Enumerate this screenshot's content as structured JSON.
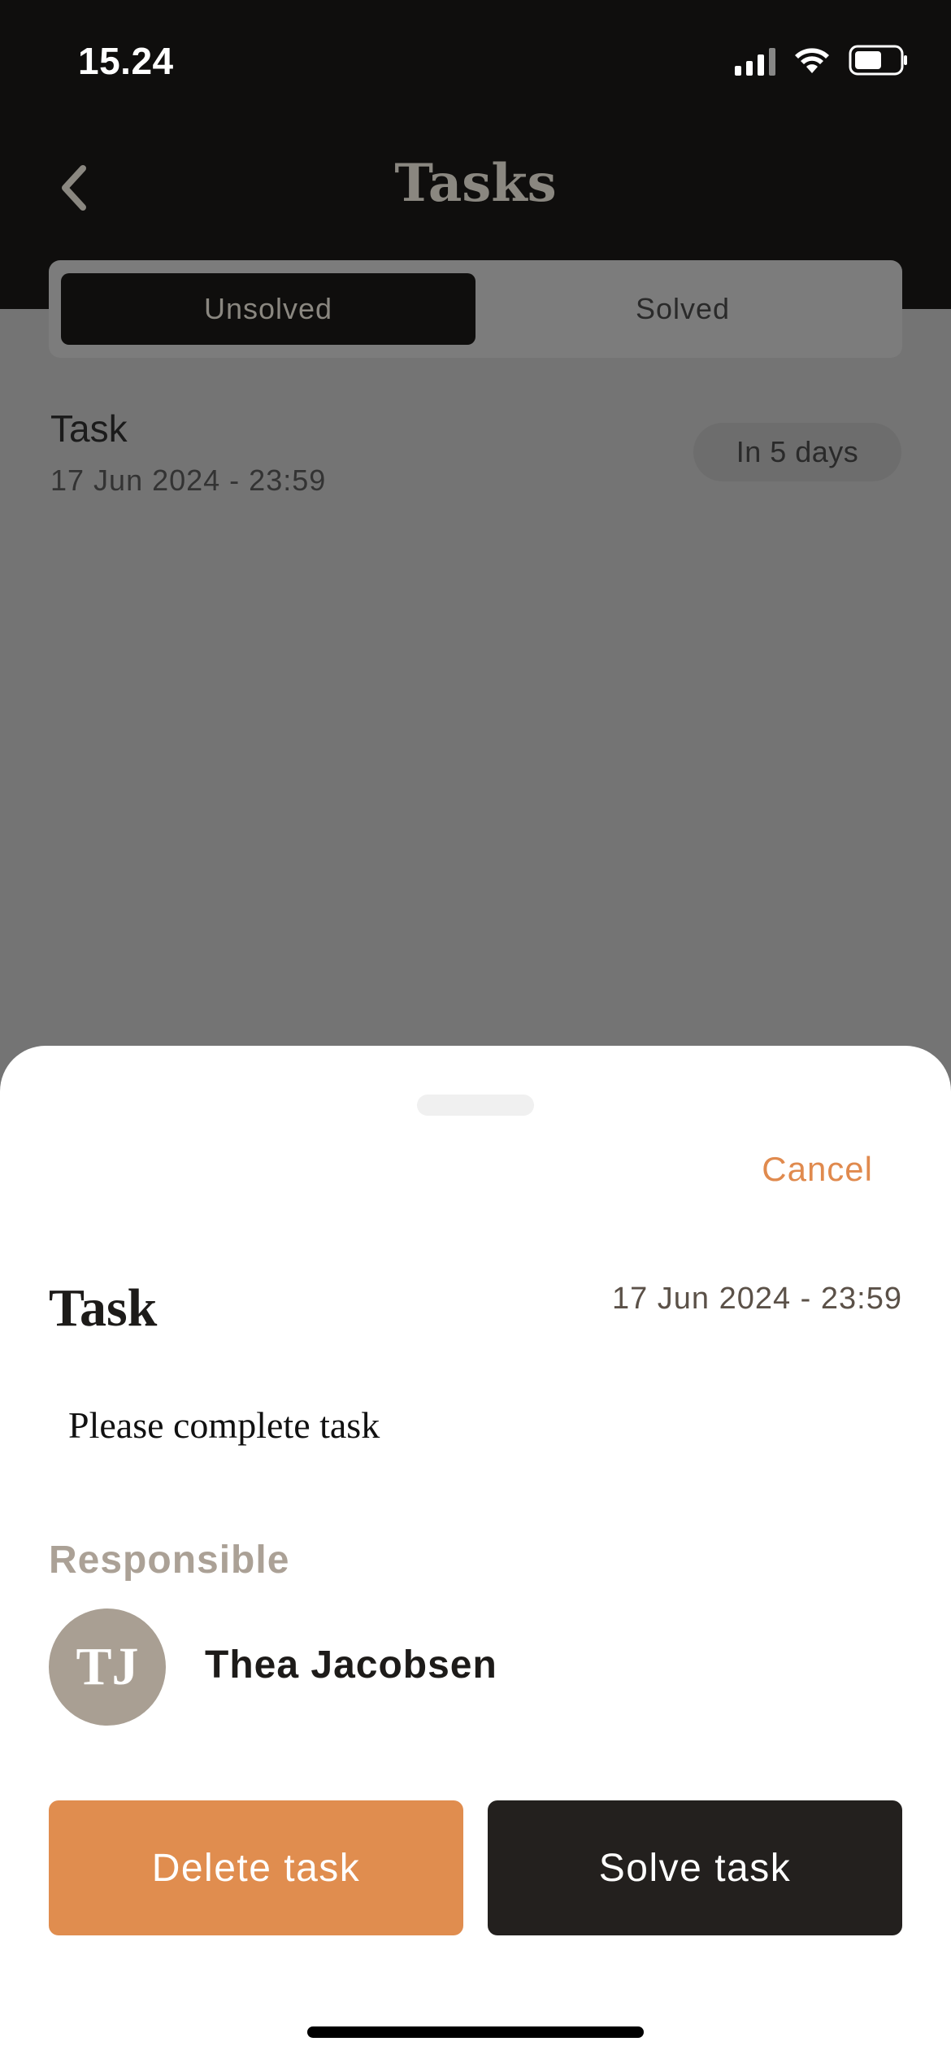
{
  "status_bar": {
    "time": "15.24"
  },
  "header": {
    "title": "Tasks"
  },
  "tabs": [
    {
      "label": "Unsolved",
      "active": true
    },
    {
      "label": "Solved",
      "active": false
    }
  ],
  "task_list": [
    {
      "title": "Task",
      "date": "17 Jun 2024 - 23:59",
      "due": "In 5 days"
    }
  ],
  "sheet": {
    "cancel_label": "Cancel",
    "title": "Task",
    "date": "17 Jun 2024 - 23:59",
    "description": "Please complete task",
    "responsible_label": "Responsible",
    "responsible": {
      "initials": "TJ",
      "name": "Thea Jacobsen"
    },
    "delete_label": "Delete task",
    "solve_label": "Solve task"
  },
  "colors": {
    "accent": "#e08d4f",
    "dark": "#23201e",
    "muted": "#aba196",
    "avatar": "#a99f93"
  }
}
